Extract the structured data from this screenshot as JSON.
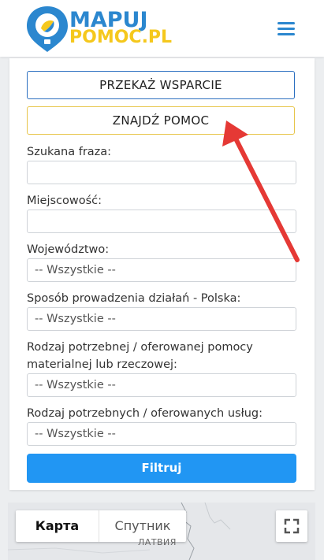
{
  "header": {
    "logo_line1": "MAPUJ",
    "logo_line2": "POMOC.PL",
    "menu_icon": "hamburger-menu-icon"
  },
  "actions": {
    "wsparcie_label": "PRZEKAŻ WSPARCIE",
    "pomoc_label": "ZNAJDŹ POMOC"
  },
  "form": {
    "phrase": {
      "label": "Szukana fraza:",
      "value": ""
    },
    "city": {
      "label": "Miejscowość:",
      "value": ""
    },
    "voivodeship": {
      "label": "Województwo:",
      "value": "-- Wszystkie --"
    },
    "mode": {
      "label": "Sposób prowadzenia działań - Polska:",
      "value": "-- Wszystkie --"
    },
    "material_line1": "Rodzaj potrzebnej / oferowanej pomocy",
    "material_line2": "materialnej lub rzeczowej:",
    "material_value": "-- Wszystkie --",
    "services": {
      "label": "Rodzaj potrzebnych / oferowanych usług:",
      "value": "-- Wszystkie --"
    },
    "filter_label": "Filtruj"
  },
  "map": {
    "tab_map": "Карта",
    "tab_satellite": "Спутник",
    "fullscreen_icon": "fullscreen-icon",
    "place_label": "ЛАТВИЯ"
  },
  "colors": {
    "brand_blue": "#2b87cf",
    "brand_yellow": "#f5c81d",
    "filter_blue": "#2196f3",
    "arrow_red": "#e53935"
  }
}
